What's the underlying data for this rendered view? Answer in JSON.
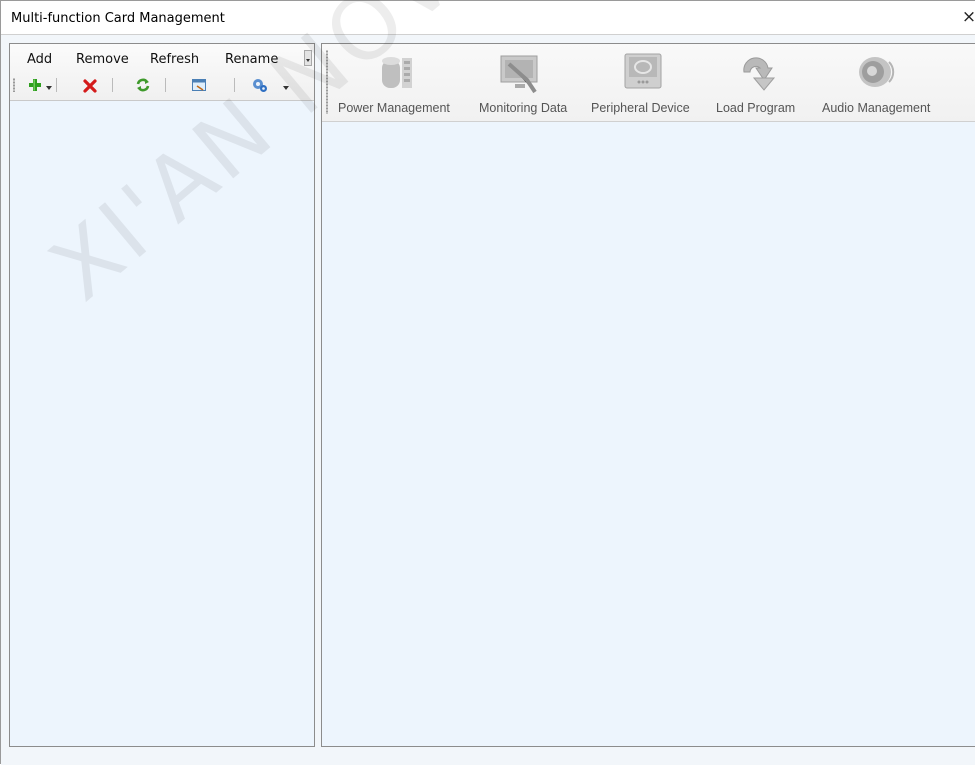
{
  "window": {
    "title": "Multi-function Card Management",
    "close_glyph": "×"
  },
  "left_toolbar": {
    "menu": [
      {
        "label": "Add"
      },
      {
        "label": "Remove"
      },
      {
        "label": "Refresh"
      },
      {
        "label": "Rename"
      }
    ],
    "icons": [
      "add-icon",
      "remove-icon",
      "refresh-icon",
      "rename-icon",
      "settings-icon"
    ]
  },
  "right_toolbar": {
    "buttons": [
      {
        "label": "Power Management",
        "icon": "power-management-icon"
      },
      {
        "label": "Monitoring Data",
        "icon": "monitoring-data-icon"
      },
      {
        "label": "Peripheral Device",
        "icon": "peripheral-device-icon"
      },
      {
        "label": "Load Program",
        "icon": "load-program-icon"
      },
      {
        "label": "Audio Management",
        "icon": "audio-management-icon"
      }
    ]
  },
  "watermark": {
    "text": "XI'AN NOVASTAR"
  },
  "colors": {
    "panel_bg": "#edf5fd",
    "border": "#8c8c8c",
    "add_green": "#2f9e1f",
    "remove_red": "#d41b1b"
  }
}
